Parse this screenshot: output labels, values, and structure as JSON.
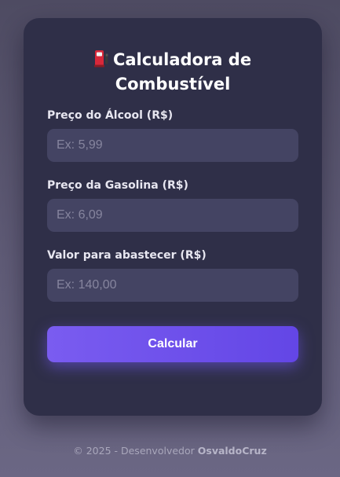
{
  "card": {
    "title": "Calculadora de Combustível",
    "title_icon": "fuel-pump-icon"
  },
  "fields": [
    {
      "label": "Preço do Álcool (R$)",
      "placeholder": "Ex: 5,99",
      "value": ""
    },
    {
      "label": "Preço da Gasolina (R$)",
      "placeholder": "Ex: 6,09",
      "value": ""
    },
    {
      "label": "Valor para abastecer (R$)",
      "placeholder": "Ex: 140,00",
      "value": ""
    }
  ],
  "button": {
    "label": "Calcular"
  },
  "footer": {
    "prefix": "© 2025 - Desenvolvedor",
    "author": "OsvaldoCruz"
  },
  "colors": {
    "card_background": "#2f2f48",
    "input_background": "#444463",
    "accent": "#6d50ea",
    "page_background": "#5c5873"
  }
}
